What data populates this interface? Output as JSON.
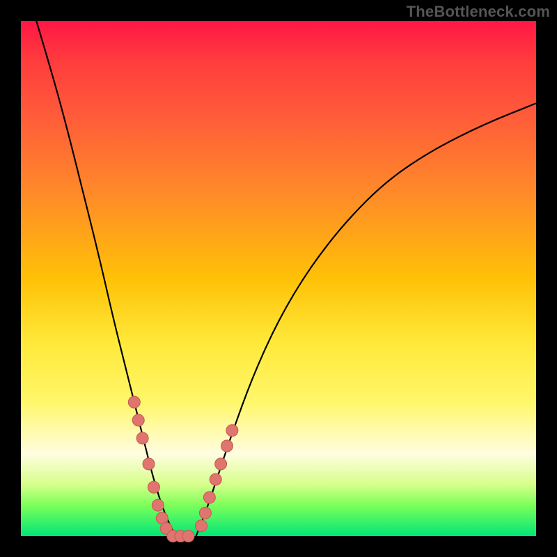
{
  "attribution": "TheBottleneck.com",
  "chart_data": {
    "type": "line",
    "title": "",
    "xlabel": "",
    "ylabel": "",
    "xlim": [
      0,
      100
    ],
    "ylim": [
      0,
      100
    ],
    "series": [
      {
        "name": "left-curve",
        "x": [
          3,
          6,
          9,
          12,
          15,
          18,
          20,
          22,
          24,
          25.5,
          27,
          28.5,
          30
        ],
        "y": [
          100,
          90,
          79,
          67,
          55,
          42,
          34,
          26,
          18,
          12,
          7,
          3,
          0
        ]
      },
      {
        "name": "right-curve",
        "x": [
          34,
          36,
          38,
          41,
          45,
          50,
          56,
          63,
          71,
          80,
          90,
          100
        ],
        "y": [
          0,
          5,
          11,
          20,
          31,
          42,
          52,
          61,
          69,
          75,
          80,
          84
        ]
      }
    ],
    "beads": {
      "left": {
        "x": [
          22.0,
          22.8,
          23.6,
          24.8,
          25.8,
          26.6,
          27.4,
          28.2
        ],
        "y": [
          26.0,
          22.5,
          19.0,
          14.0,
          9.5,
          6.0,
          3.5,
          1.5
        ]
      },
      "bottom": {
        "x": [
          29.5,
          31.0,
          32.5
        ],
        "y": [
          0.0,
          0.0,
          0.0
        ]
      },
      "right": {
        "x": [
          35.0,
          35.8,
          36.6,
          37.8,
          38.8,
          40.0,
          41.0
        ],
        "y": [
          2.0,
          4.5,
          7.5,
          11.0,
          14.0,
          17.5,
          20.5
        ]
      }
    },
    "colors": {
      "curve": "#000000",
      "bead_fill": "#e0746e",
      "bead_stroke": "#c45a50"
    }
  }
}
